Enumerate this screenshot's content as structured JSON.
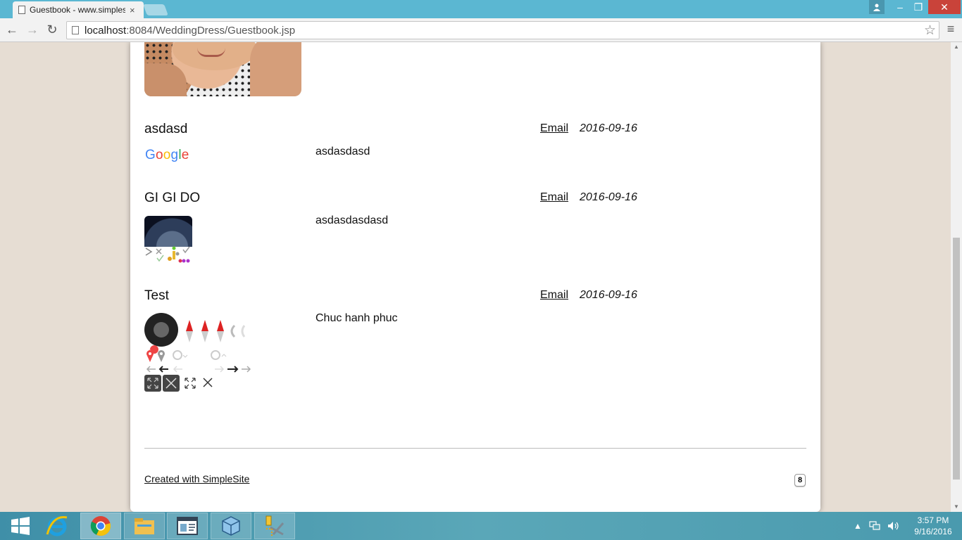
{
  "browser": {
    "tab_title": "Guestbook - www.simplesite.com",
    "tab_close": "×",
    "url_host": "localhost",
    "url_rest": ":8084/WeddingDress/Guestbook.jsp",
    "back": "←",
    "forward": "→",
    "reload": "↻",
    "star": "☆",
    "menu": "≡",
    "win_min": "–",
    "win_max": "❐",
    "win_close": "✕",
    "user_icon": "user-icon"
  },
  "entries": [
    {
      "name": "asdasd",
      "email_label": "Email",
      "date": "2016-09-16",
      "message": "asdasdasd"
    },
    {
      "name": "GI GI DO",
      "email_label": "Email",
      "date": "2016-09-16",
      "message": "asdasdasdasd"
    },
    {
      "name": "Test",
      "email_label": "Email",
      "date": "2016-09-16",
      "message": "Chuc hanh phuc"
    }
  ],
  "google_logo": {
    "g1": "G",
    "o1": "o",
    "o2": "o",
    "g2": "g",
    "l": "l",
    "e": "e"
  },
  "colors": {
    "blue": "#4285f4",
    "red": "#ea4335",
    "yellow": "#fbbc05",
    "green": "#34a853"
  },
  "footer": {
    "link": "Created with SimpleSite",
    "badge": "8"
  },
  "taskbar": {
    "time": "3:57 PM",
    "date": "9/16/2016"
  }
}
